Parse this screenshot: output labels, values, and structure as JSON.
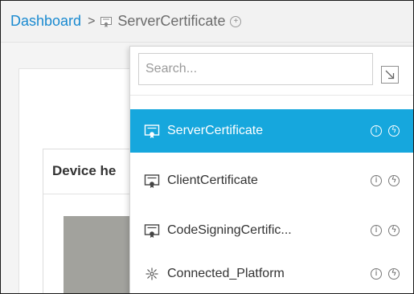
{
  "breadcrumb": {
    "root": "Dashboard",
    "separator": ">",
    "current": "ServerCertificate",
    "current_icon": "certificate-icon",
    "add_icon": "circle-plus-icon"
  },
  "background": {
    "panel_title": "Device he"
  },
  "dropdown": {
    "search": {
      "placeholder": "Search...",
      "value": ""
    },
    "expand_icon": "expand-arrow-icon",
    "items": [
      {
        "label": "ServerCertificate",
        "icon": "certificate-icon",
        "selected": true,
        "info_icon": "info-icon",
        "action_icon": "lightning-icon"
      },
      {
        "label": "ClientCertificate",
        "icon": "certificate-icon",
        "selected": false,
        "info_icon": "info-icon",
        "action_icon": "lightning-icon"
      },
      {
        "label": "CodeSigningCertific...",
        "icon": "certificate-icon",
        "selected": false,
        "info_icon": "info-icon",
        "action_icon": "lightning-icon"
      },
      {
        "label": "Connected_Platform",
        "icon": "connected-platform-icon",
        "selected": false,
        "info_icon": "info-icon",
        "action_icon": "lightning-icon"
      }
    ]
  },
  "colors": {
    "accent": "#16a7dd",
    "link": "#1a8ad0"
  }
}
